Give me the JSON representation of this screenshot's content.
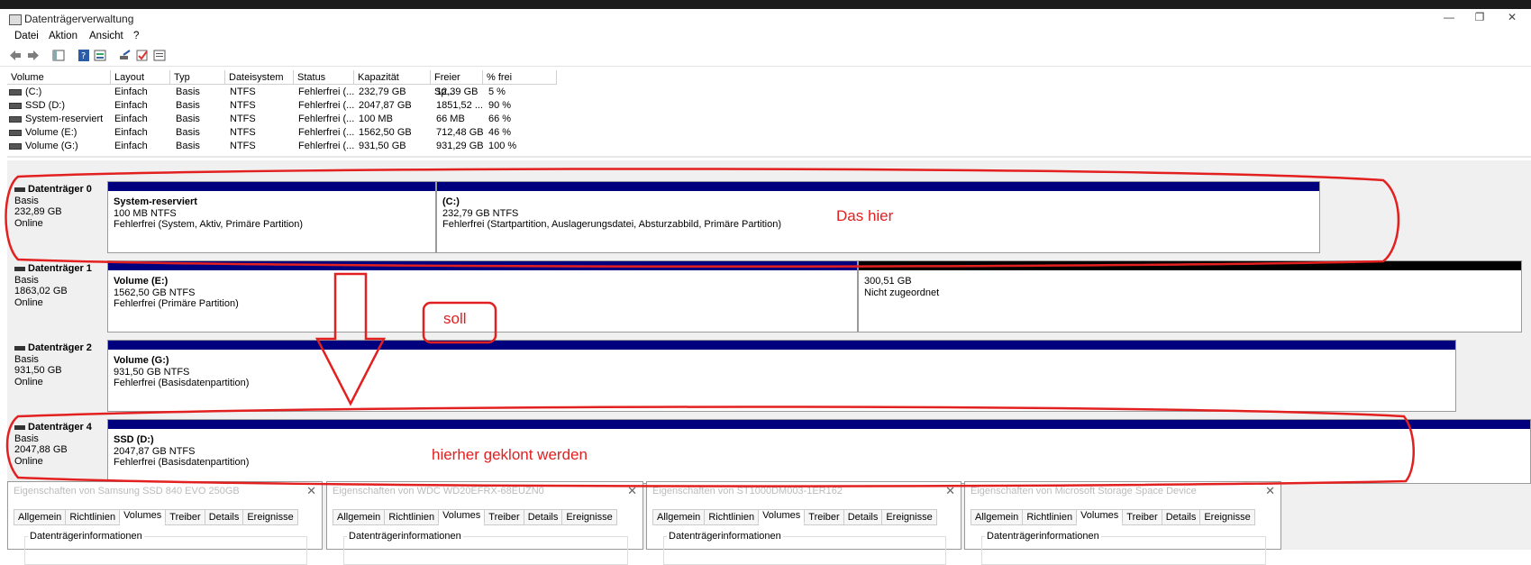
{
  "window": {
    "title": "Datenträgerverwaltung",
    "controls": [
      "—",
      "❐",
      "✕"
    ]
  },
  "menu": [
    "Datei",
    "Aktion",
    "Ansicht",
    "?"
  ],
  "toolbar_icons": [
    "back-icon",
    "forward-icon",
    "console-tree-icon",
    "help-icon",
    "properties-icon",
    "connect-icon",
    "check-icon",
    "list-icon"
  ],
  "list": {
    "columns": [
      "Volume",
      "Layout",
      "Typ",
      "Dateisystem",
      "Status",
      "Kapazität",
      "Freier Sp...",
      "% frei"
    ],
    "rows": [
      [
        "(C:)",
        "Einfach",
        "Basis",
        "NTFS",
        "Fehlerfrei (...",
        "232,79 GB",
        "12,39 GB",
        "5 %"
      ],
      [
        "SSD (D:)",
        "Einfach",
        "Basis",
        "NTFS",
        "Fehlerfrei (...",
        "2047,87 GB",
        "1851,52 ...",
        "90 %"
      ],
      [
        "System-reserviert",
        "Einfach",
        "Basis",
        "NTFS",
        "Fehlerfrei (...",
        "100 MB",
        "66 MB",
        "66 %"
      ],
      [
        "Volume (E:)",
        "Einfach",
        "Basis",
        "NTFS",
        "Fehlerfrei (...",
        "1562,50 GB",
        "712,48 GB",
        "46 %"
      ],
      [
        "Volume (G:)",
        "Einfach",
        "Basis",
        "NTFS",
        "Fehlerfrei (...",
        "931,50 GB",
        "931,29 GB",
        "100 %"
      ]
    ]
  },
  "disks": [
    {
      "name": "Datenträger 0",
      "type": "Basis",
      "size": "232,89 GB",
      "status": "Online",
      "partitions": [
        {
          "name": "System-reserviert",
          "size": "100 MB NTFS",
          "status": "Fehlerfrei (System, Aktiv, Primäre Partition)"
        },
        {
          "name": "(C:)",
          "size": "232,79 GB NTFS",
          "status": "Fehlerfrei (Startpartition, Auslagerungsdatei, Absturzabbild, Primäre Partition)"
        }
      ]
    },
    {
      "name": "Datenträger 1",
      "type": "Basis",
      "size": "1863,02 GB",
      "status": "Online",
      "partitions": [
        {
          "name": "Volume  (E:)",
          "size": "1562,50 GB NTFS",
          "status": "Fehlerfrei (Primäre Partition)"
        },
        {
          "name": "",
          "size": "300,51 GB",
          "status": "Nicht zugeordnet"
        }
      ]
    },
    {
      "name": "Datenträger 2",
      "type": "Basis",
      "size": "931,50 GB",
      "status": "Online",
      "partitions": [
        {
          "name": "Volume  (G:)",
          "size": "931,50 GB NTFS",
          "status": "Fehlerfrei (Basisdatenpartition)"
        }
      ]
    },
    {
      "name": "Datenträger 4",
      "type": "Basis",
      "size": "2047,88 GB",
      "status": "Online",
      "partitions": [
        {
          "name": "SSD  (D:)",
          "size": "2047,87 GB NTFS",
          "status": "Fehlerfrei (Basisdatenpartition)"
        }
      ]
    }
  ],
  "annotations": {
    "text1": "Das hier",
    "text2": "soll",
    "text3": "hierher geklont werden",
    "color": "#e32020"
  },
  "dialogs": [
    {
      "title": "Eigenschaften von Samsung SSD 840 EVO 250GB",
      "tabs": [
        "Allgemein",
        "Richtlinien",
        "Volumes",
        "Treiber",
        "Details",
        "Ereignisse"
      ],
      "active": "Volumes",
      "group": "Datenträgerinformationen"
    },
    {
      "title": "Eigenschaften von WDC WD20EFRX-68EUZN0",
      "tabs": [
        "Allgemein",
        "Richtlinien",
        "Volumes",
        "Treiber",
        "Details",
        "Ereignisse"
      ],
      "active": "Volumes",
      "group": "Datenträgerinformationen"
    },
    {
      "title": "Eigenschaften von ST1000DM003-1ER162",
      "tabs": [
        "Allgemein",
        "Richtlinien",
        "Volumes",
        "Treiber",
        "Details",
        "Ereignisse"
      ],
      "active": "Volumes",
      "group": "Datenträgerinformationen"
    },
    {
      "title": "Eigenschaften von Microsoft Storage Space Device",
      "tabs": [
        "Allgemein",
        "Richtlinien",
        "Volumes",
        "Treiber",
        "Details",
        "Ereignisse"
      ],
      "active": "Volumes",
      "group": "Datenträgerinformationen"
    }
  ]
}
